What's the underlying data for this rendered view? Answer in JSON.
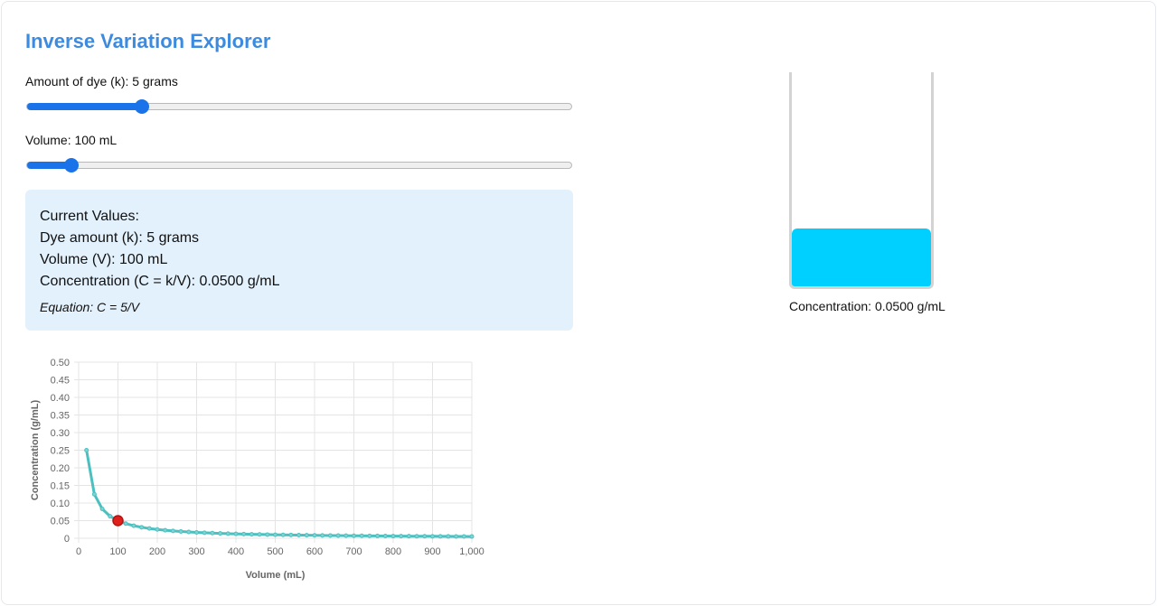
{
  "app": {
    "title": "Inverse Variation Explorer"
  },
  "controls": {
    "dye": {
      "label_prefix": "Amount of dye (k): ",
      "value": 5,
      "unit": " grams",
      "min": 1,
      "max": 20
    },
    "volume": {
      "label_prefix": "Volume: ",
      "value": 100,
      "unit": " mL",
      "min": 20,
      "max": 1000
    }
  },
  "values_panel": {
    "heading": "Current Values:",
    "dye_line": "Dye amount (k): 5 grams",
    "volume_line": "Volume (V): 100 mL",
    "concentration_line": "Concentration (C = k/V): 0.0500 g/mL",
    "equation": "Equation: C = 5/V"
  },
  "beaker": {
    "fill_fraction": 0.27,
    "liquid_color": "#00d0ff",
    "label": "Concentration: 0.0500 g/mL"
  },
  "colors": {
    "accent": "#3d8bdf",
    "slider": "#1a73e8",
    "curve": "#4bc0c0",
    "marker": "#e0201b"
  },
  "chart_data": {
    "type": "line",
    "k": 5,
    "x_start": 20,
    "x_end": 1000,
    "x_step": 20,
    "xlabel": "Volume (mL)",
    "ylabel": "Concentration (g/mL)",
    "xlim": [
      0,
      1000
    ],
    "ylim": [
      0,
      0.5
    ],
    "xticks": [
      0,
      100,
      200,
      300,
      400,
      500,
      600,
      700,
      800,
      900,
      1000
    ],
    "xtick_labels": [
      "0",
      "100",
      "200",
      "300",
      "400",
      "500",
      "600",
      "700",
      "800",
      "900",
      "1,000"
    ],
    "yticks": [
      0,
      0.05,
      0.1,
      0.15,
      0.2,
      0.25,
      0.3,
      0.35,
      0.4,
      0.45,
      0.5
    ],
    "ytick_labels": [
      "0",
      "0.05",
      "0.10",
      "0.15",
      "0.20",
      "0.25",
      "0.30",
      "0.35",
      "0.40",
      "0.45",
      "0.50"
    ],
    "current_point": {
      "x": 100,
      "y": 0.05
    },
    "grid": true
  }
}
